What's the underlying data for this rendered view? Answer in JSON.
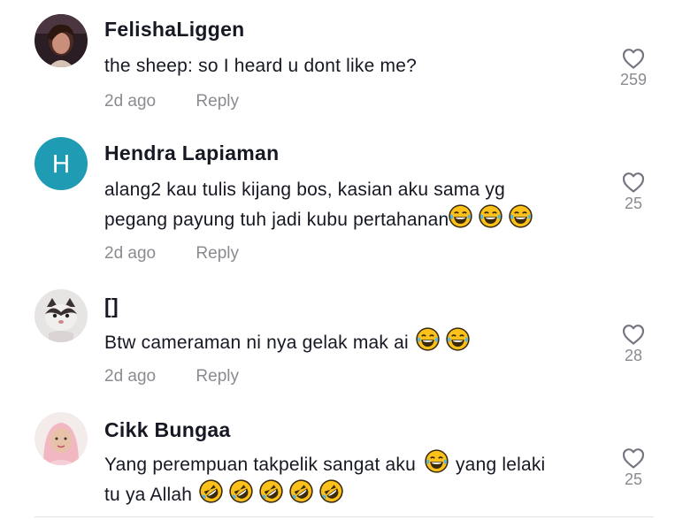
{
  "comments": [
    {
      "username": "FelishaLiggen",
      "avatar": "photo-avatar-woman",
      "text": "the sheep: so I heard u dont like me?",
      "time": "2d ago",
      "reply": "Reply",
      "likes": "259"
    },
    {
      "username": "Hendra Lapiaman",
      "avatar_letter": "H",
      "text_line1": "alang2 kau tulis kijang bos, kasian aku sama yg",
      "text_line2": "pegang payung tuh jadi kubu pertahanan",
      "time": "2d ago",
      "reply": "Reply",
      "likes": "25"
    },
    {
      "username": "[]",
      "avatar": "photo-avatar-cat",
      "text": "Btw cameraman ni nya gelak mak ai",
      "time": "2d ago",
      "reply": "Reply",
      "likes": "28"
    },
    {
      "username": "Cikk Bungaa",
      "avatar": "photo-avatar-woman-hijab",
      "text_part1": "Yang perempuan takpelik sangat aku",
      "text_part2": "yang lelaki",
      "text_line2": "tu ya Allah",
      "likes": "25"
    }
  ],
  "icons": {
    "like": "heart-outline-icon",
    "emoji_joy": "tears-of-joy-emoji",
    "emoji_rofl": "rolling-on-floor-laughing-emoji"
  },
  "colors": {
    "text": "#161823",
    "muted": "#8a8b91",
    "avatar_teal": "#1f9bb3"
  }
}
